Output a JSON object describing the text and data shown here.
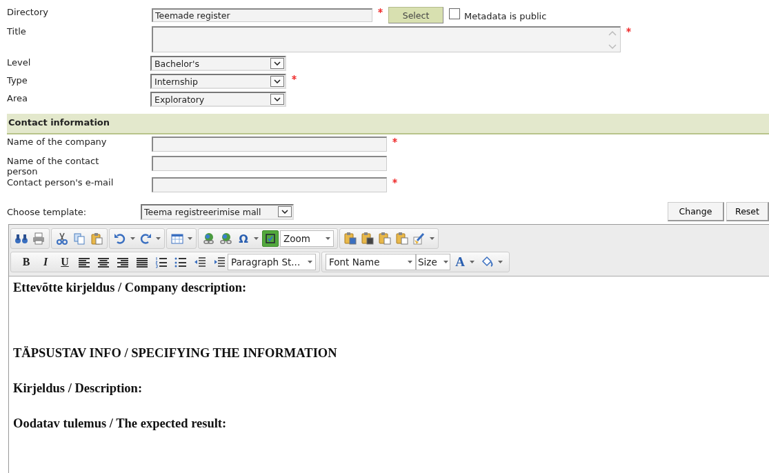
{
  "form": {
    "directory": {
      "label": "Directory",
      "value": "Teemade register",
      "required": true,
      "button": "Select"
    },
    "metadata_public": {
      "label": "Metadata is public",
      "checked": false
    },
    "title": {
      "label": "Title",
      "required": true
    },
    "selects": [
      {
        "label": "Level",
        "value": "Bachelor's",
        "required": false
      },
      {
        "label": "Type",
        "value": "Internship",
        "required": true
      },
      {
        "label": "Area",
        "value": "Exploratory",
        "required": false
      }
    ]
  },
  "contact": {
    "heading": "Contact information",
    "fields": [
      {
        "label": "Name of the company",
        "required": true
      },
      {
        "label": "Name of the contact person",
        "required": false
      },
      {
        "label": "Contact person's e-mail",
        "required": true
      }
    ]
  },
  "template": {
    "label": "Choose template:",
    "value": "Teema registreerimise mall",
    "buttons": [
      "Change",
      "Reset"
    ]
  },
  "toolbar": {
    "special_char": "Ω",
    "zoom": "Zoom",
    "toggle_on": true,
    "bold": "B",
    "italic": "I",
    "underline": "U",
    "paragraph_style": "Paragraph St...",
    "font_name": "Font Name",
    "size": "Size",
    "font_color": "A"
  },
  "editor": {
    "paragraphs": [
      "Ettevõtte kirjeldus / Company description:",
      "TÄPSUSTAV INFO / SPECIFYING THE INFORMATION",
      "Kirjeldus / Description:",
      "Oodatav tulemus / The expected result:"
    ]
  }
}
